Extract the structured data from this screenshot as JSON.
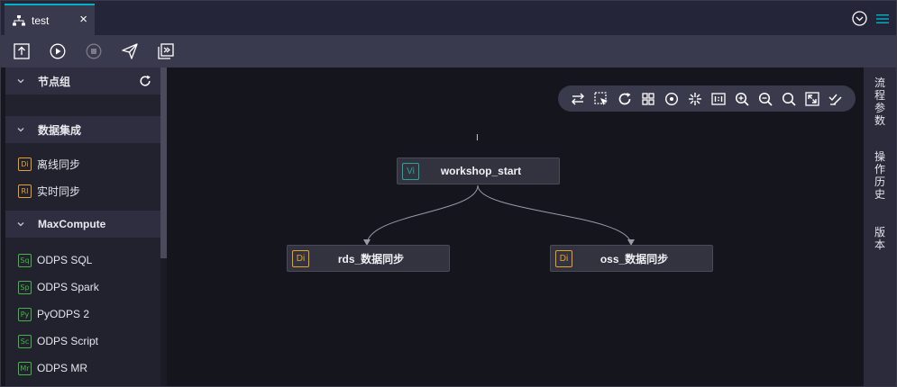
{
  "tab": {
    "title": "test",
    "close": "×"
  },
  "sidebar": {
    "groups": [
      {
        "title": "节点组",
        "items": []
      },
      {
        "title": "数据集成",
        "items": [
          {
            "badge": "Di",
            "label": "离线同步"
          },
          {
            "badge": "RI",
            "label": "实时同步"
          }
        ]
      },
      {
        "title": "MaxCompute",
        "items": [
          {
            "badge": "Sq",
            "label": "ODPS SQL"
          },
          {
            "badge": "Sp",
            "label": "ODPS Spark"
          },
          {
            "badge": "Py",
            "label": "PyODPS 2"
          },
          {
            "badge": "Sc",
            "label": "ODPS Script"
          },
          {
            "badge": "Mr",
            "label": "ODPS MR"
          }
        ]
      }
    ]
  },
  "canvas": {
    "cursor_mark": "I",
    "nodes": [
      {
        "badge": "Vi",
        "label": "workshop_start"
      },
      {
        "badge": "Di",
        "label": "rds_数据同步"
      },
      {
        "badge": "Di",
        "label": "oss_数据同步"
      }
    ]
  },
  "right_panel": {
    "items": [
      {
        "label": "流程参数"
      },
      {
        "label": "操作历史"
      },
      {
        "label": "版本"
      }
    ]
  },
  "colors": {
    "accent": "#00b3c7",
    "orange_badge": "#e8a030",
    "green_badge": "#47b347",
    "teal_badge": "#22a89a"
  }
}
